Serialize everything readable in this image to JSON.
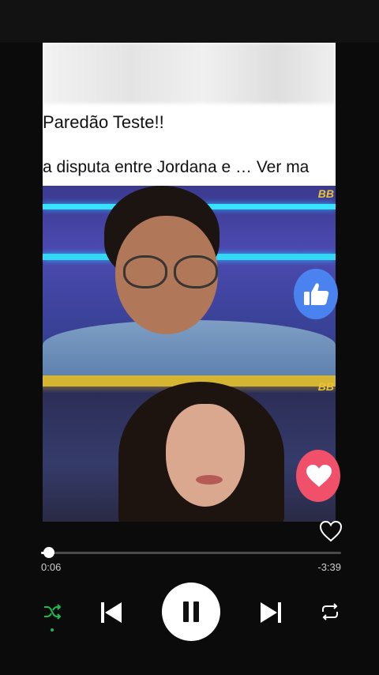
{
  "post": {
    "title": "Paredão Teste!!",
    "description": "a disputa entre Jordana e … Ver ma",
    "image_tag_top": "BB",
    "image_tag_bottom": "BB"
  },
  "reactions": {
    "like_icon": "thumbs-up-icon",
    "love_icon": "heart-icon"
  },
  "player": {
    "progress": 0.027,
    "elapsed": "0:06",
    "remaining": "-3:39",
    "shuffle_active": true,
    "colors": {
      "accent": "#1db954",
      "like": "#4a82f0",
      "love": "#f0506a"
    }
  }
}
